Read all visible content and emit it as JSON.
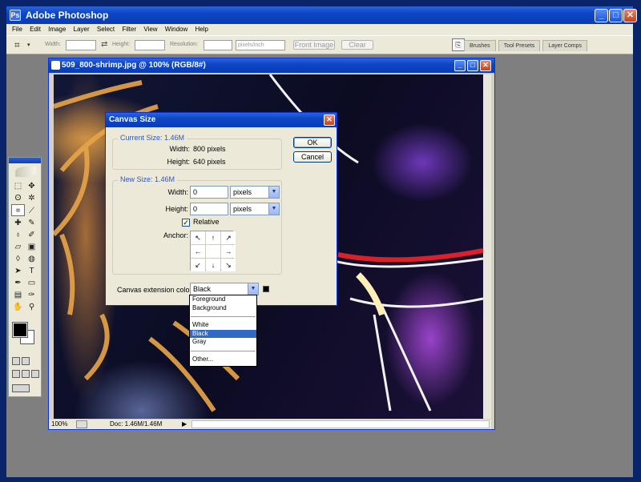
{
  "app": {
    "title": "Adobe Photoshop",
    "icon": "photoshop-icon"
  },
  "menu": [
    "File",
    "Edit",
    "Image",
    "Layer",
    "Select",
    "Filter",
    "View",
    "Window",
    "Help"
  ],
  "options_bar": {
    "width_label": "Width:",
    "height_label": "Height:",
    "resolution_label": "Resolution:",
    "resolution_unit": "pixels/inch",
    "front_image": "Front Image",
    "clear": "Clear"
  },
  "palette_well": [
    "Brushes",
    "Tool Presets",
    "Layer Comps"
  ],
  "document": {
    "title": "509_800-shrimp.jpg @ 100% (RGB/8#)",
    "zoom": "100%",
    "doc_info": "Doc: 1.46M/1.46M"
  },
  "dialog": {
    "title": "Canvas Size",
    "ok": "OK",
    "cancel": "Cancel",
    "current_size_legend": "Current Size: 1.46M",
    "current_width_label": "Width:",
    "current_width_value": "800 pixels",
    "current_height_label": "Height:",
    "current_height_value": "640 pixels",
    "new_size_legend": "New Size: 1.46M",
    "width_label": "Width:",
    "width_value": "0",
    "width_unit": "pixels",
    "height_label": "Height:",
    "height_value": "0",
    "height_unit": "pixels",
    "relative_label": "Relative",
    "relative_checked": true,
    "anchor_label": "Anchor:",
    "extension_label": "Canvas extension color:",
    "extension_value": "Black",
    "extension_swatch_color": "#000000"
  },
  "extension_options": [
    "Foreground",
    "Background",
    "White",
    "Black",
    "Gray",
    "Other..."
  ],
  "extension_selected": "Black"
}
